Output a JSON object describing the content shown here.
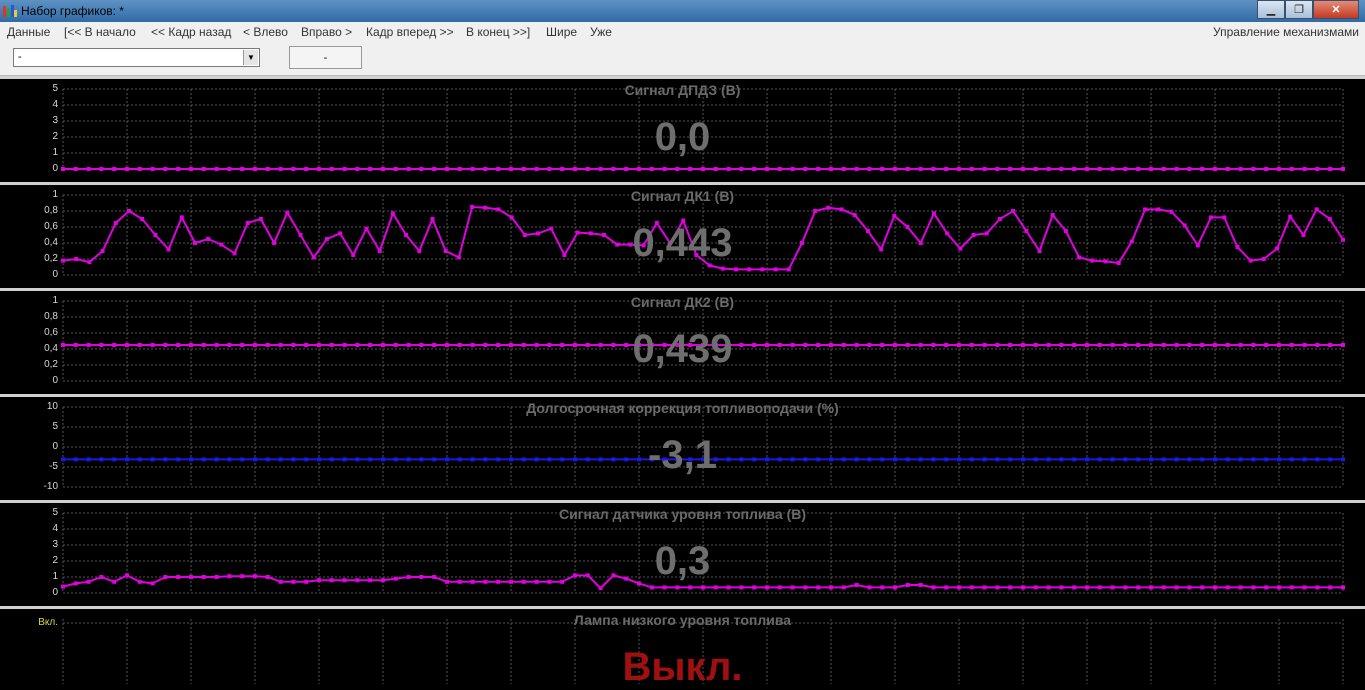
{
  "window": {
    "title": "Набор графиков: *"
  },
  "menu": {
    "items": [
      "Данные",
      "[<< В начало",
      "<< Кадр назад",
      "< Влево",
      "Вправо >",
      "Кадр вперед >>",
      "В конец >>]",
      "Шире",
      "Уже"
    ],
    "right": "Управление механизмами"
  },
  "toolbar": {
    "combo_value": "-",
    "value_box": "-"
  },
  "panels": [
    {
      "title": "Сигнал ДПДЗ  (В)",
      "value": "0,0",
      "yticks": [
        "5",
        "4",
        "3",
        "2",
        "1",
        "0"
      ],
      "ymin": 0,
      "ymax": 5,
      "color": "#e000e0",
      "series": [
        0,
        0,
        0,
        0,
        0,
        0,
        0,
        0,
        0,
        0,
        0,
        0,
        0,
        0,
        0,
        0,
        0,
        0,
        0,
        0,
        0,
        0,
        0,
        0,
        0,
        0,
        0,
        0,
        0,
        0,
        0,
        0,
        0,
        0,
        0,
        0,
        0,
        0,
        0,
        0,
        0,
        0,
        0,
        0,
        0,
        0,
        0,
        0,
        0,
        0,
        0,
        0,
        0,
        0,
        0,
        0,
        0,
        0,
        0,
        0,
        0,
        0,
        0,
        0,
        0,
        0,
        0,
        0,
        0,
        0,
        0,
        0,
        0,
        0,
        0,
        0,
        0,
        0,
        0,
        0,
        0,
        0,
        0,
        0,
        0,
        0,
        0,
        0,
        0,
        0,
        0,
        0,
        0,
        0,
        0,
        0,
        0,
        0,
        0,
        0,
        0
      ]
    },
    {
      "title": "Сигнал ДК1  (В)",
      "value": "0,443",
      "yticks": [
        "1",
        "0,8",
        "0,6",
        "0,4",
        "0,2",
        "0"
      ],
      "ymin": 0,
      "ymax": 1,
      "color": "#e000e0",
      "series": [
        0.18,
        0.2,
        0.16,
        0.3,
        0.65,
        0.8,
        0.7,
        0.5,
        0.32,
        0.72,
        0.4,
        0.45,
        0.38,
        0.27,
        0.65,
        0.7,
        0.4,
        0.78,
        0.5,
        0.22,
        0.45,
        0.52,
        0.25,
        0.58,
        0.3,
        0.77,
        0.5,
        0.3,
        0.7,
        0.3,
        0.22,
        0.85,
        0.84,
        0.82,
        0.72,
        0.5,
        0.52,
        0.58,
        0.25,
        0.53,
        0.52,
        0.5,
        0.38,
        0.38,
        0.37,
        0.65,
        0.4,
        0.68,
        0.25,
        0.12,
        0.08,
        0.07,
        0.07,
        0.07,
        0.07,
        0.07,
        0.4,
        0.8,
        0.84,
        0.82,
        0.75,
        0.55,
        0.32,
        0.74,
        0.6,
        0.4,
        0.77,
        0.52,
        0.33,
        0.5,
        0.52,
        0.7,
        0.8,
        0.55,
        0.3,
        0.75,
        0.55,
        0.22,
        0.18,
        0.17,
        0.15,
        0.42,
        0.82,
        0.82,
        0.79,
        0.62,
        0.37,
        0.72,
        0.72,
        0.35,
        0.18,
        0.2,
        0.33,
        0.73,
        0.5,
        0.82,
        0.7,
        0.44
      ]
    },
    {
      "title": "Сигнал ДК2  (В)",
      "value": "0,439",
      "yticks": [
        "1",
        "0,8",
        "0,6",
        "0,4",
        "0,2",
        "0"
      ],
      "ymin": 0,
      "ymax": 1,
      "color": "#e000e0",
      "series": [
        0.45,
        0.45,
        0.45,
        0.45,
        0.45,
        0.45,
        0.45,
        0.45,
        0.45,
        0.45,
        0.45,
        0.45,
        0.45,
        0.45,
        0.45,
        0.45,
        0.45,
        0.45,
        0.45,
        0.45,
        0.45,
        0.45,
        0.45,
        0.45,
        0.45,
        0.45,
        0.45,
        0.45,
        0.45,
        0.45,
        0.45,
        0.45,
        0.45,
        0.45,
        0.45,
        0.45,
        0.45,
        0.45,
        0.45,
        0.45,
        0.45,
        0.45,
        0.45,
        0.45,
        0.45,
        0.45,
        0.45,
        0.45,
        0.45,
        0.45,
        0.45,
        0.45,
        0.45,
        0.45,
        0.45,
        0.45,
        0.45,
        0.45,
        0.45,
        0.45,
        0.45,
        0.45,
        0.45,
        0.45,
        0.45,
        0.45,
        0.45,
        0.45,
        0.45,
        0.45,
        0.45,
        0.45,
        0.45,
        0.45,
        0.45,
        0.45,
        0.45,
        0.45,
        0.45,
        0.45,
        0.45,
        0.45,
        0.45,
        0.45,
        0.45,
        0.45,
        0.45,
        0.45,
        0.45,
        0.45,
        0.45,
        0.45,
        0.45,
        0.45,
        0.45,
        0.45,
        0.45,
        0.45,
        0.45,
        0.45,
        0.45
      ]
    },
    {
      "title": "Долгосрочная коррекция топливоподачи  (%)",
      "value": "-3,1",
      "yticks": [
        "10",
        "5",
        "0",
        "-5",
        "-10"
      ],
      "ymin": -10,
      "ymax": 10,
      "color": "#1a1ae0",
      "series": [
        -3.1,
        -3.1,
        -3.1,
        -3.1,
        -3.1,
        -3.1,
        -3.1,
        -3.1,
        -3.1,
        -3.1,
        -3.1,
        -3.1,
        -3.1,
        -3.1,
        -3.1,
        -3.1,
        -3.1,
        -3.1,
        -3.1,
        -3.1,
        -3.1,
        -3.1,
        -3.1,
        -3.1,
        -3.1,
        -3.1,
        -3.1,
        -3.1,
        -3.1,
        -3.1,
        -3.1,
        -3.1,
        -3.1,
        -3.1,
        -3.1,
        -3.1,
        -3.1,
        -3.1,
        -3.1,
        -3.1,
        -3.1,
        -3.1,
        -3.1,
        -3.1,
        -3.1,
        -3.1,
        -3.1,
        -3.1,
        -3.1,
        -3.1,
        -3.1,
        -3.1,
        -3.1,
        -3.1,
        -3.1,
        -3.1,
        -3.1,
        -3.1,
        -3.1,
        -3.1,
        -3.1,
        -3.1,
        -3.1,
        -3.1,
        -3.1,
        -3.1,
        -3.1,
        -3.1,
        -3.1,
        -3.1,
        -3.1,
        -3.1,
        -3.1,
        -3.1,
        -3.1,
        -3.1,
        -3.1,
        -3.1,
        -3.1,
        -3.1,
        -3.1,
        -3.1,
        -3.1,
        -3.1,
        -3.1,
        -3.1,
        -3.1,
        -3.1,
        -3.1,
        -3.1,
        -3.1,
        -3.1,
        -3.1,
        -3.1,
        -3.1,
        -3.1,
        -3.1,
        -3.1,
        -3.1,
        -3.1,
        -3.1
      ]
    },
    {
      "title": "Сигнал датчика уровня топлива  (В)",
      "value": "0,3",
      "yticks": [
        "5",
        "4",
        "3",
        "2",
        "1",
        "0"
      ],
      "ymin": 0,
      "ymax": 5,
      "color": "#e000e0",
      "series": [
        0.4,
        0.6,
        0.7,
        1.0,
        0.7,
        1.1,
        0.7,
        0.6,
        1.0,
        1.0,
        1.0,
        1.0,
        1.0,
        1.05,
        1.05,
        1.05,
        1.0,
        0.7,
        0.7,
        0.7,
        0.8,
        0.8,
        0.8,
        0.8,
        0.8,
        0.8,
        0.9,
        1.0,
        1.0,
        1.0,
        0.7,
        0.7,
        0.7,
        0.7,
        0.7,
        0.7,
        0.7,
        0.7,
        0.7,
        0.7,
        1.1,
        1.1,
        0.3,
        1.1,
        0.9,
        0.6,
        0.35,
        0.35,
        0.35,
        0.35,
        0.35,
        0.35,
        0.35,
        0.35,
        0.35,
        0.35,
        0.35,
        0.35,
        0.35,
        0.35,
        0.35,
        0.35,
        0.5,
        0.35,
        0.35,
        0.35,
        0.5,
        0.5,
        0.35,
        0.35,
        0.35,
        0.35,
        0.35,
        0.35,
        0.35,
        0.35,
        0.35,
        0.35,
        0.35,
        0.35,
        0.35,
        0.35,
        0.35,
        0.35,
        0.35,
        0.35,
        0.35,
        0.35,
        0.35,
        0.35,
        0.35,
        0.35,
        0.35,
        0.35,
        0.35,
        0.35,
        0.35,
        0.35,
        0.35,
        0.35,
        0.35
      ]
    },
    {
      "title": "Лампа низкого уровня топлива",
      "value": "Выкл.",
      "yticks": [
        "Вкл."
      ],
      "ymin": 0,
      "ymax": 1,
      "color": "#a01010",
      "series": []
    }
  ],
  "chart_data": [
    {
      "type": "line",
      "title": "Сигнал ДПДЗ  (В)",
      "ylim": [
        0,
        5
      ]
    },
    {
      "type": "line",
      "title": "Сигнал ДК1  (В)",
      "ylim": [
        0,
        1
      ]
    },
    {
      "type": "line",
      "title": "Сигнал ДК2  (В)",
      "ylim": [
        0,
        1
      ]
    },
    {
      "type": "line",
      "title": "Долгосрочная коррекция топливоподачи  (%)",
      "ylim": [
        -10,
        10
      ]
    },
    {
      "type": "line",
      "title": "Сигнал датчика уровня топлива  (В)",
      "ylim": [
        0,
        5
      ]
    }
  ],
  "colors": {
    "grid": "#555555",
    "panel_border": "#d0d0d0",
    "value_text": "#6e6e6e"
  }
}
